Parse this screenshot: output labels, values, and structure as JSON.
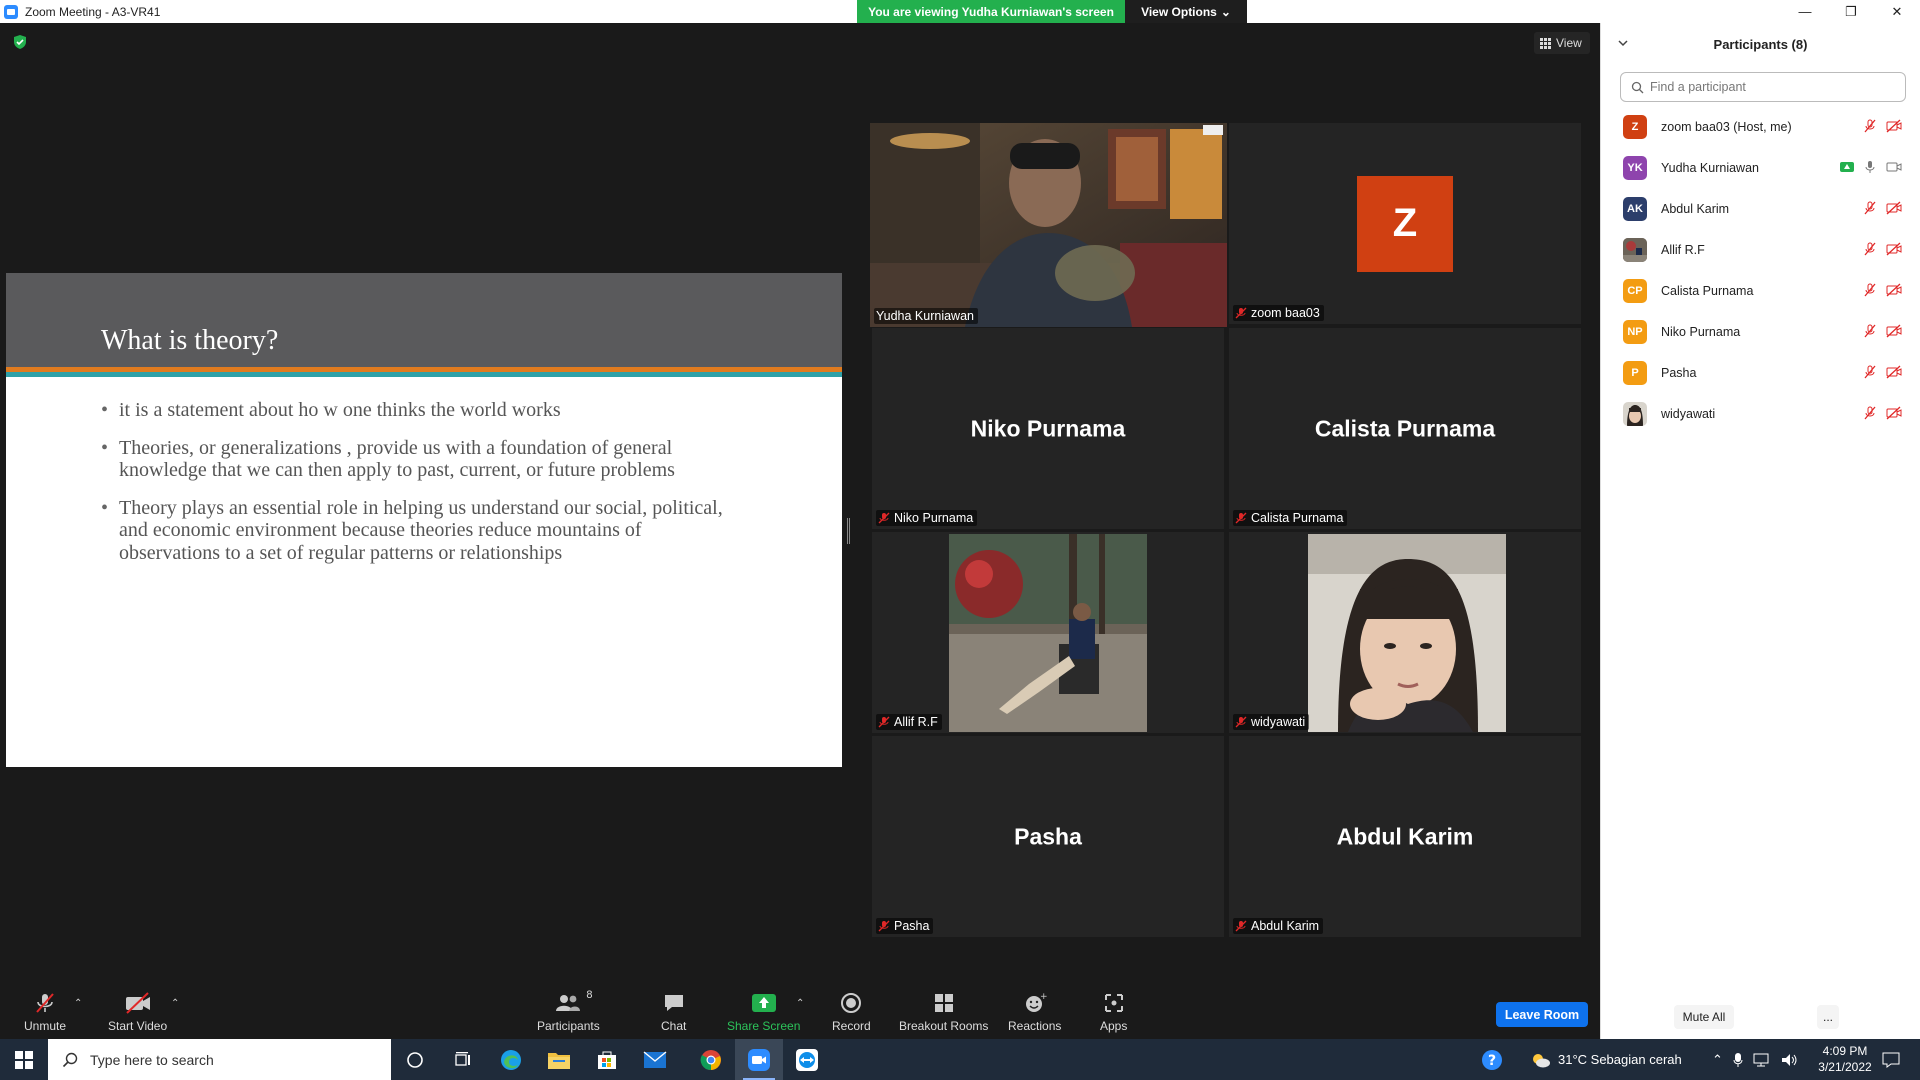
{
  "window": {
    "title": "Zoom Meeting - A3-VR41",
    "minimize": "—",
    "restore": "❐",
    "close": "✕"
  },
  "banner": {
    "message": "You are viewing Yudha Kurniawan's screen",
    "view_options": "View Options"
  },
  "meeting": {
    "view_label": "View"
  },
  "slide": {
    "title": "What is theory?",
    "bullets": [
      "it is a statement about ho w one thinks the world works",
      "Theories, or  generalizations , provide us with a foundation of general knowledge that we can then apply to past, current, or future problems",
      "Theory plays an essential role in helping us understand our social, political, and economic environment because theories reduce mountains of observations to a set of regular patterns or relationships"
    ]
  },
  "tiles": [
    {
      "label": "Yudha Kurniawan",
      "big": "",
      "type": "video-speaker"
    },
    {
      "label": "zoom baa03",
      "big": "",
      "type": "avatar",
      "avatar_letter": "Z"
    },
    {
      "label": "Niko Purnama",
      "big": "Niko Purnama",
      "type": "name"
    },
    {
      "label": "Calista Purnama",
      "big": "Calista Purnama",
      "type": "name"
    },
    {
      "label": "Allif R.F",
      "big": "",
      "type": "photo"
    },
    {
      "label": "widyawati",
      "big": "",
      "type": "photo"
    },
    {
      "label": "Pasha",
      "big": "Pasha",
      "type": "name"
    },
    {
      "label": "Abdul Karim",
      "big": "Abdul Karim",
      "type": "name"
    }
  ],
  "toolbar": {
    "unmute": "Unmute",
    "start_video": "Start Video",
    "participants": "Participants",
    "participants_count": "8",
    "chat": "Chat",
    "share_screen": "Share Screen",
    "record": "Record",
    "breakout_rooms": "Breakout Rooms",
    "reactions": "Reactions",
    "apps": "Apps",
    "leave": "Leave Room"
  },
  "panel": {
    "title": "Participants (8)",
    "search_placeholder": "Find a participant",
    "participants": [
      {
        "initials": "Z",
        "name": "zoom baa03 (Host, me)",
        "color": "#d04012"
      },
      {
        "initials": "YK",
        "name": "Yudha Kurniawan",
        "color": "#8e44ad"
      },
      {
        "initials": "AK",
        "name": "Abdul Karim",
        "color": "#2c3e6b"
      },
      {
        "initials": "",
        "name": "Allif R.F",
        "color": "#7a6a5a"
      },
      {
        "initials": "CP",
        "name": "Calista Purnama",
        "color": "#f39c12"
      },
      {
        "initials": "NP",
        "name": "Niko Purnama",
        "color": "#f39c12"
      },
      {
        "initials": "P",
        "name": "Pasha",
        "color": "#f39c12"
      },
      {
        "initials": "",
        "name": "widyawati",
        "color": "#9a8070"
      }
    ],
    "mute_all": "Mute All",
    "more": "..."
  },
  "taskbar": {
    "search_placeholder": "Type here to search",
    "weather": "31°C  Sebagian cerah",
    "time": "4:09 PM",
    "date": "3/21/2022"
  },
  "colors": {
    "speaker_border": "#e8ee5a",
    "banner_green": "#23b04e",
    "leave_blue": "#0e72ed"
  }
}
